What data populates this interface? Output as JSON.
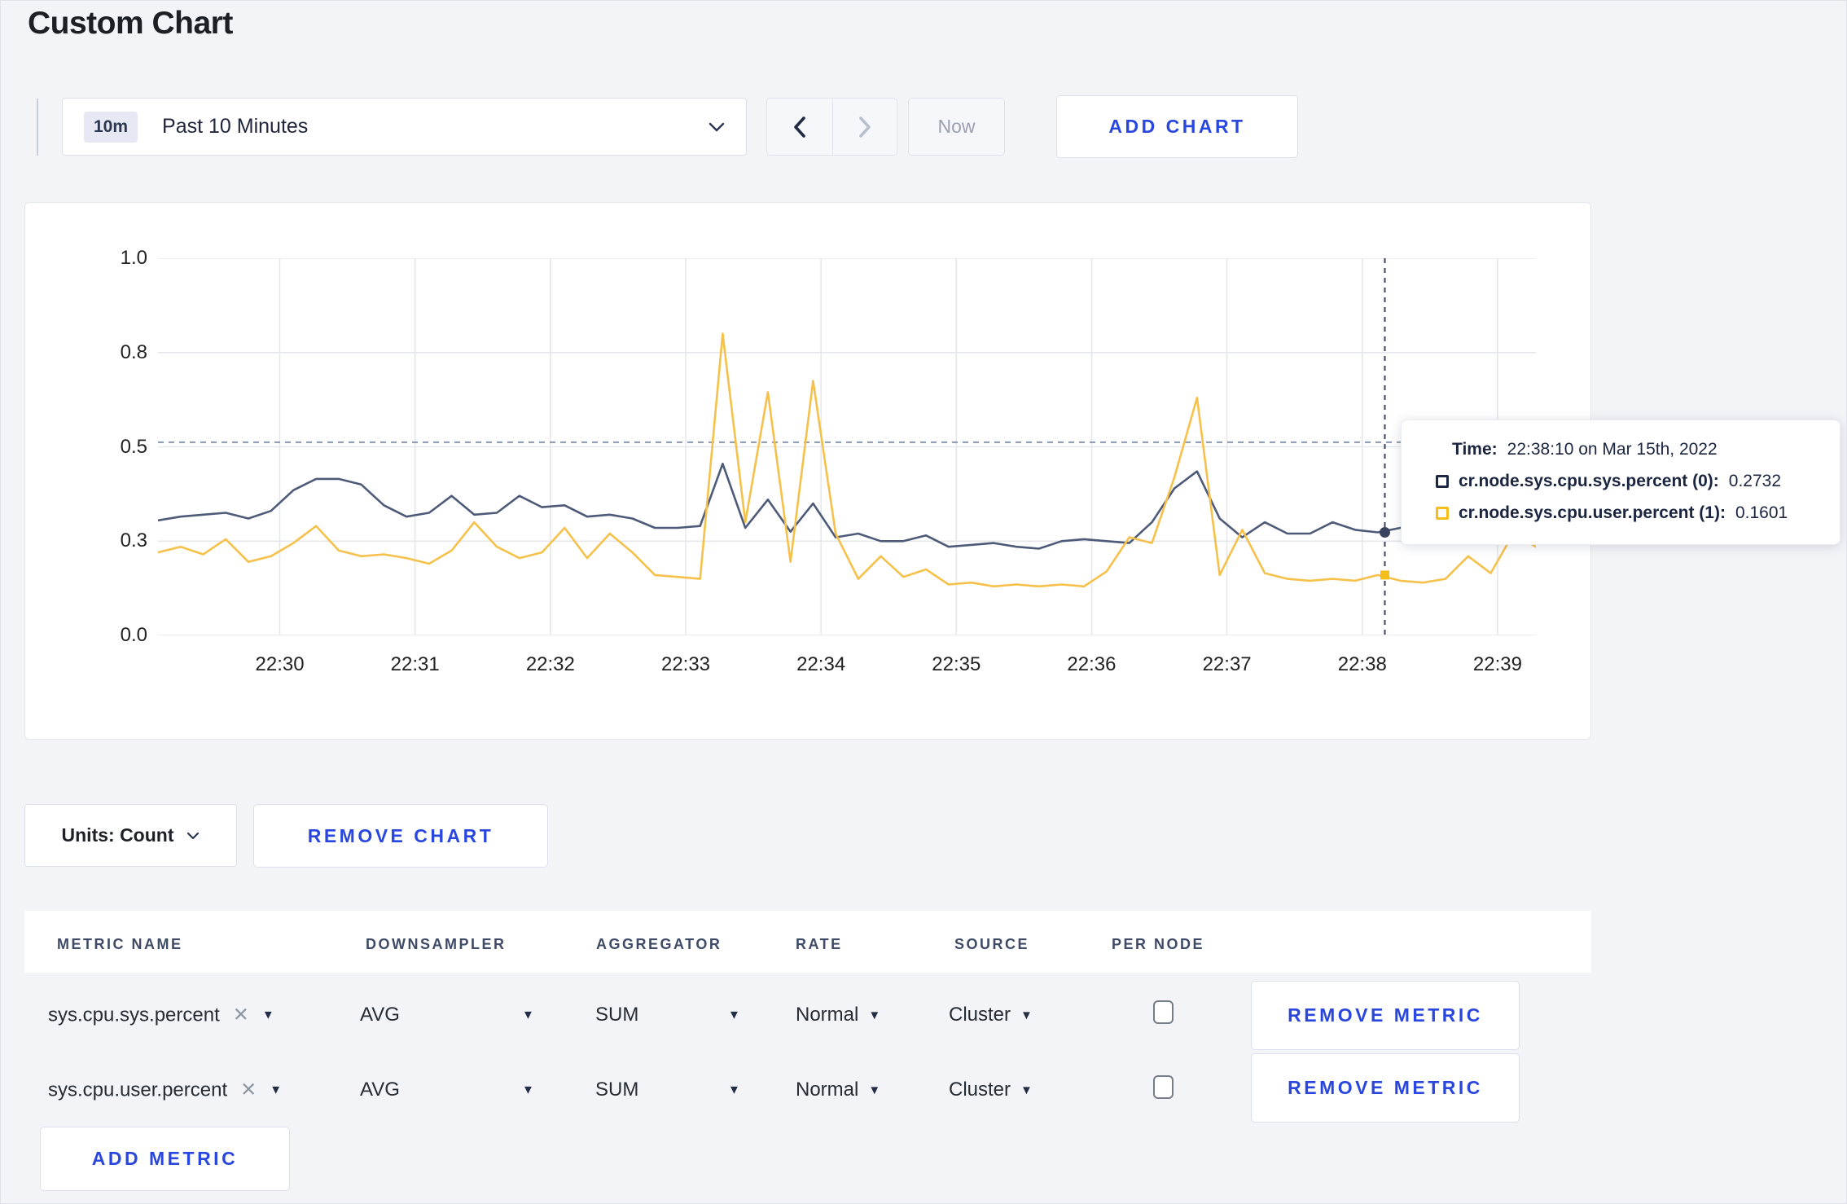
{
  "page": {
    "title": "Custom Chart",
    "background": "#f2f4f8",
    "accent_blue": "#2946df"
  },
  "toolbar": {
    "range_badge": "10m",
    "range_label": "Past 10 Minutes",
    "now_label": "Now",
    "add_chart_label": "ADD CHART"
  },
  "chart_data": {
    "type": "line",
    "ylim": [
      0,
      1
    ],
    "grid": true,
    "y_gridlines": [
      {
        "v": 0.0,
        "label": "0.0"
      },
      {
        "v": 0.25,
        "label": "0.3"
      },
      {
        "v": 0.5,
        "label": "0.5"
      },
      {
        "v": 0.75,
        "label": "0.8"
      },
      {
        "v": 1.0,
        "label": "1.0"
      }
    ],
    "x_ticks": [
      {
        "t": 0,
        "label": "22:30"
      },
      {
        "t": 60,
        "label": "22:31"
      },
      {
        "t": 120,
        "label": "22:32"
      },
      {
        "t": 180,
        "label": "22:33"
      },
      {
        "t": 240,
        "label": "22:34"
      },
      {
        "t": 300,
        "label": "22:35"
      },
      {
        "t": 360,
        "label": "22:36"
      },
      {
        "t": 420,
        "label": "22:37"
      },
      {
        "t": 480,
        "label": "22:38"
      },
      {
        "t": 540,
        "label": "22:39"
      }
    ],
    "x_range_seconds": [
      -54,
      557
    ],
    "sample_step_seconds": 10,
    "gridline_color": "#e5e7eb",
    "series": [
      {
        "name": "cr.node.sys.cpu.sys.percent",
        "color": "#4d5a78",
        "values": [
          0.305,
          0.315,
          0.32,
          0.325,
          0.31,
          0.33,
          0.385,
          0.415,
          0.415,
          0.4,
          0.345,
          0.315,
          0.325,
          0.37,
          0.32,
          0.325,
          0.37,
          0.34,
          0.345,
          0.315,
          0.32,
          0.31,
          0.285,
          0.285,
          0.29,
          0.455,
          0.285,
          0.36,
          0.275,
          0.35,
          0.26,
          0.27,
          0.25,
          0.25,
          0.265,
          0.235,
          0.24,
          0.245,
          0.235,
          0.23,
          0.25,
          0.255,
          0.25,
          0.245,
          0.3,
          0.39,
          0.435,
          0.31,
          0.26,
          0.3,
          0.27,
          0.27,
          0.3,
          0.28,
          0.2732,
          0.285,
          0.3,
          0.295,
          0.285,
          0.29,
          0.3,
          0.31
        ]
      },
      {
        "name": "cr.node.sys.cpu.user.percent",
        "color": "#f6c14a",
        "values": [
          0.22,
          0.235,
          0.215,
          0.255,
          0.195,
          0.21,
          0.245,
          0.29,
          0.225,
          0.21,
          0.215,
          0.205,
          0.19,
          0.225,
          0.3,
          0.235,
          0.205,
          0.22,
          0.285,
          0.205,
          0.27,
          0.22,
          0.16,
          0.155,
          0.15,
          0.8,
          0.3,
          0.645,
          0.195,
          0.675,
          0.27,
          0.15,
          0.21,
          0.155,
          0.175,
          0.135,
          0.14,
          0.13,
          0.135,
          0.13,
          0.135,
          0.13,
          0.17,
          0.26,
          0.245,
          0.42,
          0.63,
          0.16,
          0.28,
          0.165,
          0.15,
          0.145,
          0.15,
          0.145,
          0.1601,
          0.145,
          0.14,
          0.15,
          0.21,
          0.165,
          0.27,
          0.235
        ]
      }
    ],
    "hover": {
      "t": 490,
      "guide_value": 0.512,
      "crosshair_color": "#39435e",
      "guide_color": "#8a97ad",
      "time_label_title": "Time:",
      "time_label": "22:38:10 on Mar 15th, 2022",
      "points": [
        {
          "label": "cr.node.sys.cpu.sys.percent (0):",
          "value": "0.2732",
          "swatch_color": "#1c2743",
          "y": 0.2732
        },
        {
          "label": "cr.node.sys.cpu.user.percent (1):",
          "value": "0.1601",
          "swatch_color": "#f5bf1b",
          "y": 0.1601
        }
      ]
    }
  },
  "units_row": {
    "units_label": "Units: Count",
    "remove_chart_label": "REMOVE CHART"
  },
  "metrics_table": {
    "headers": [
      "METRIC NAME",
      "DOWNSAMPLER",
      "AGGREGATOR",
      "RATE",
      "SOURCE",
      "PER NODE"
    ],
    "remove_metric_label": "REMOVE METRIC",
    "add_metric_label": "ADD METRIC",
    "rows": [
      {
        "metric_name": "sys.cpu.sys.percent",
        "clear_icon": "✕",
        "downsampler": "AVG",
        "aggregator": "SUM",
        "rate": "Normal",
        "source": "Cluster",
        "per_node_checked": false
      },
      {
        "metric_name": "sys.cpu.user.percent",
        "clear_icon": "✕",
        "downsampler": "AVG",
        "aggregator": "SUM",
        "rate": "Normal",
        "source": "Cluster",
        "per_node_checked": false
      }
    ]
  }
}
